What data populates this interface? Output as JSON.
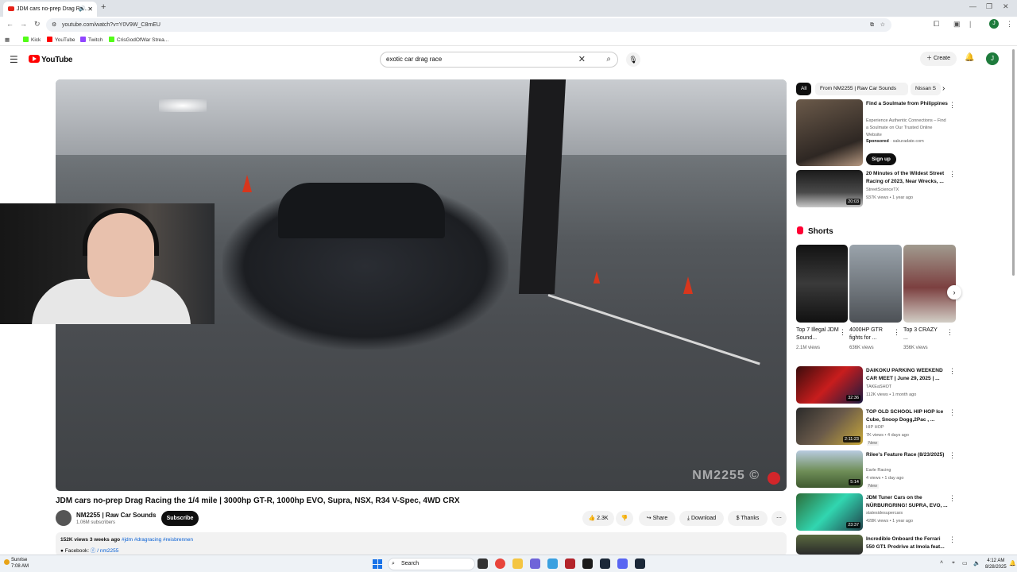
{
  "browser": {
    "tab_title": "JDM cars no-prep Drag Ra...",
    "new_tab": "+",
    "url": "youtube.com/watch?v=Y0V9W_C8mEU",
    "bookmarks": [
      "Kick",
      "YouTube",
      "Twitch",
      "CrisGodOfWar Strea..."
    ],
    "bookmark_colors": [
      "#53fc18",
      "#ff0000",
      "#9146ff",
      "#53fc18"
    ],
    "profile_initial": "J"
  },
  "header": {
    "logo_text": "YouTube",
    "search_query": "exotic car drag race",
    "create_label": "Create",
    "avatar_initial": "J"
  },
  "video": {
    "watermark": "NM2255 ©",
    "title": "JDM cars no-prep Drag Racing the 1/4 mile | 3000hp GT-R, 1000hp EVO, Supra, NSX, R34 V-Spec, 4WD CRX",
    "channel_name": "NM2255 | Raw Car Sounds",
    "subscribers": "1.06M subscribers",
    "subscribe_label": "Subscribe",
    "likes": "2.3K",
    "share_label": "Share",
    "download_label": "Download",
    "thanks_label": "Thanks",
    "views_date": "152K views  3 weeks ago",
    "hashtags": "#jdm #dragracing #reisbrennen",
    "desc_line2": "● Facebook:",
    "desc_link": "/ nm2255"
  },
  "sidebar": {
    "chips": [
      "All",
      "From NM2255 | Raw Car Sounds",
      "Nissan S"
    ],
    "ad": {
      "title": "Find a Soulmate from Philippines",
      "desc": "Experience Authentic Connections – Find a Soulmate on Our Trusted Online Website",
      "sponsored": "Sponsored",
      "domain": "· sakuradate.com",
      "cta": "Sign up"
    },
    "top_video": {
      "title": "20 Minutes of the Wildest Street Racing of 2023, Near Wrecks, ...",
      "channel": "StreetScienceTX",
      "meta": "937K views • 1 year ago",
      "duration": "20:03"
    },
    "shorts_heading": "Shorts",
    "shorts": [
      {
        "title": "Top 7 Illegal JDM Sound...",
        "views": "2.1M views"
      },
      {
        "title": "4000HP GTR fights for ...",
        "views": "636K views"
      },
      {
        "title": "Top 3 CRAZY ...",
        "views": "356K views"
      }
    ],
    "videos": [
      {
        "title": "DAIKOKU PARKING WEEKEND CAR MEET | June 29, 2025 | ...",
        "channel": "TAKEaSHOT",
        "meta": "112K views • 1 month ago",
        "badge": "",
        "duration": "32:36"
      },
      {
        "title": "TOP OLD SCHOOL HIP HOP Ice Cube, Snoop Dogg,2Pac , ...",
        "channel": "HIP HOP",
        "meta": "7K views • 4 days ago",
        "badge": "New",
        "duration": "2:11:23"
      },
      {
        "title": "Rilee's Feature Race (8/23/2025)",
        "channel": "Earle Racing",
        "meta": "4 views • 1 day ago",
        "badge": "New",
        "duration": "5:14"
      },
      {
        "title": "JDM Tuner Cars on the NÜRBURGRING! SUPRA, EVO, ...",
        "channel": "statesidesupercars",
        "meta": "428K views • 1 year ago",
        "badge": "",
        "duration": "23:37"
      },
      {
        "title": "Incredible Onboard the Ferrari 550 GT1 Prodrive at Imola feat...",
        "channel": "",
        "meta": "",
        "badge": "",
        "duration": ""
      }
    ]
  },
  "taskbar": {
    "weather_name": "Sunrise",
    "weather_time": "7:08 AM",
    "search_placeholder": "Search",
    "time": "4:12 AM",
    "date": "8/28/2025"
  }
}
